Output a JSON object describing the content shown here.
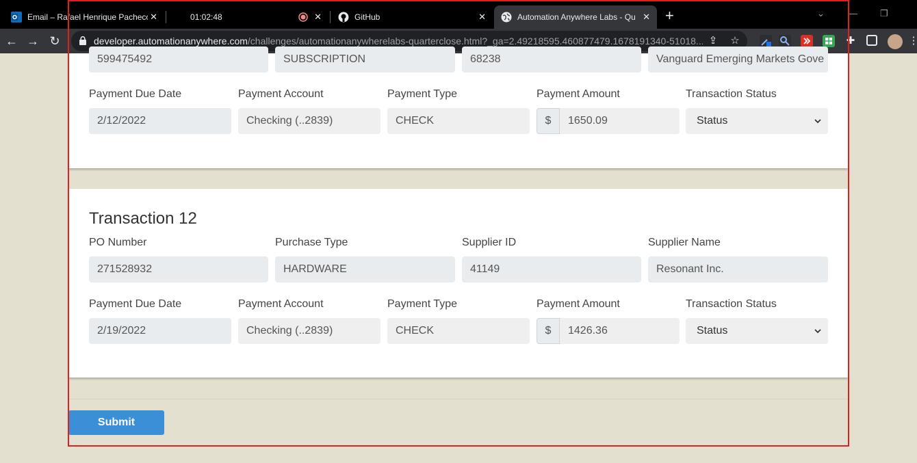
{
  "browser": {
    "tabs": [
      {
        "title": "Email – Rafael Henrique Pacheco",
        "icon": "outlook-icon"
      },
      {
        "title": "01:02:48",
        "icon": "recording-icon"
      },
      {
        "title": "GitHub",
        "icon": "github-icon"
      },
      {
        "title": "Automation Anywhere Labs - Qu",
        "icon": "globe-icon"
      }
    ],
    "url_host": "developer.automationanywhere.com",
    "url_path": "/challenges/automationanywherelabs-quarterclose.html?_ga=2.49218595.460877479.1678191340-51018..."
  },
  "partial_row": {
    "po_number": "599475492",
    "purchase_type": "SUBSCRIPTION",
    "supplier_id": "68238",
    "supplier_name": "Vanguard Emerging Markets Gove"
  },
  "labels": {
    "payment_due_date": "Payment Due Date",
    "payment_account": "Payment Account",
    "payment_type": "Payment Type",
    "payment_amount": "Payment Amount",
    "transaction_status": "Transaction Status",
    "po_number": "PO Number",
    "purchase_type": "Purchase Type",
    "supplier_id": "Supplier ID",
    "supplier_name": "Supplier Name",
    "currency": "$"
  },
  "transaction11": {
    "payment_due_date": "2/12/2022",
    "payment_account": "Checking (..2839)",
    "payment_type": "CHECK",
    "payment_amount": "1650.09",
    "status": "Status"
  },
  "transaction12": {
    "title": "Transaction 12",
    "po_number": "271528932",
    "purchase_type": "HARDWARE",
    "supplier_id": "41149",
    "supplier_name": "Resonant Inc.",
    "payment_due_date": "2/19/2022",
    "payment_account": "Checking (..2839)",
    "payment_type": "CHECK",
    "payment_amount": "1426.36",
    "status": "Status"
  },
  "submit_label": "Submit",
  "colors": {
    "page_bg": "#e4e0cf",
    "submit": "#3a8fd6",
    "highlight_frame": "#e02020"
  }
}
